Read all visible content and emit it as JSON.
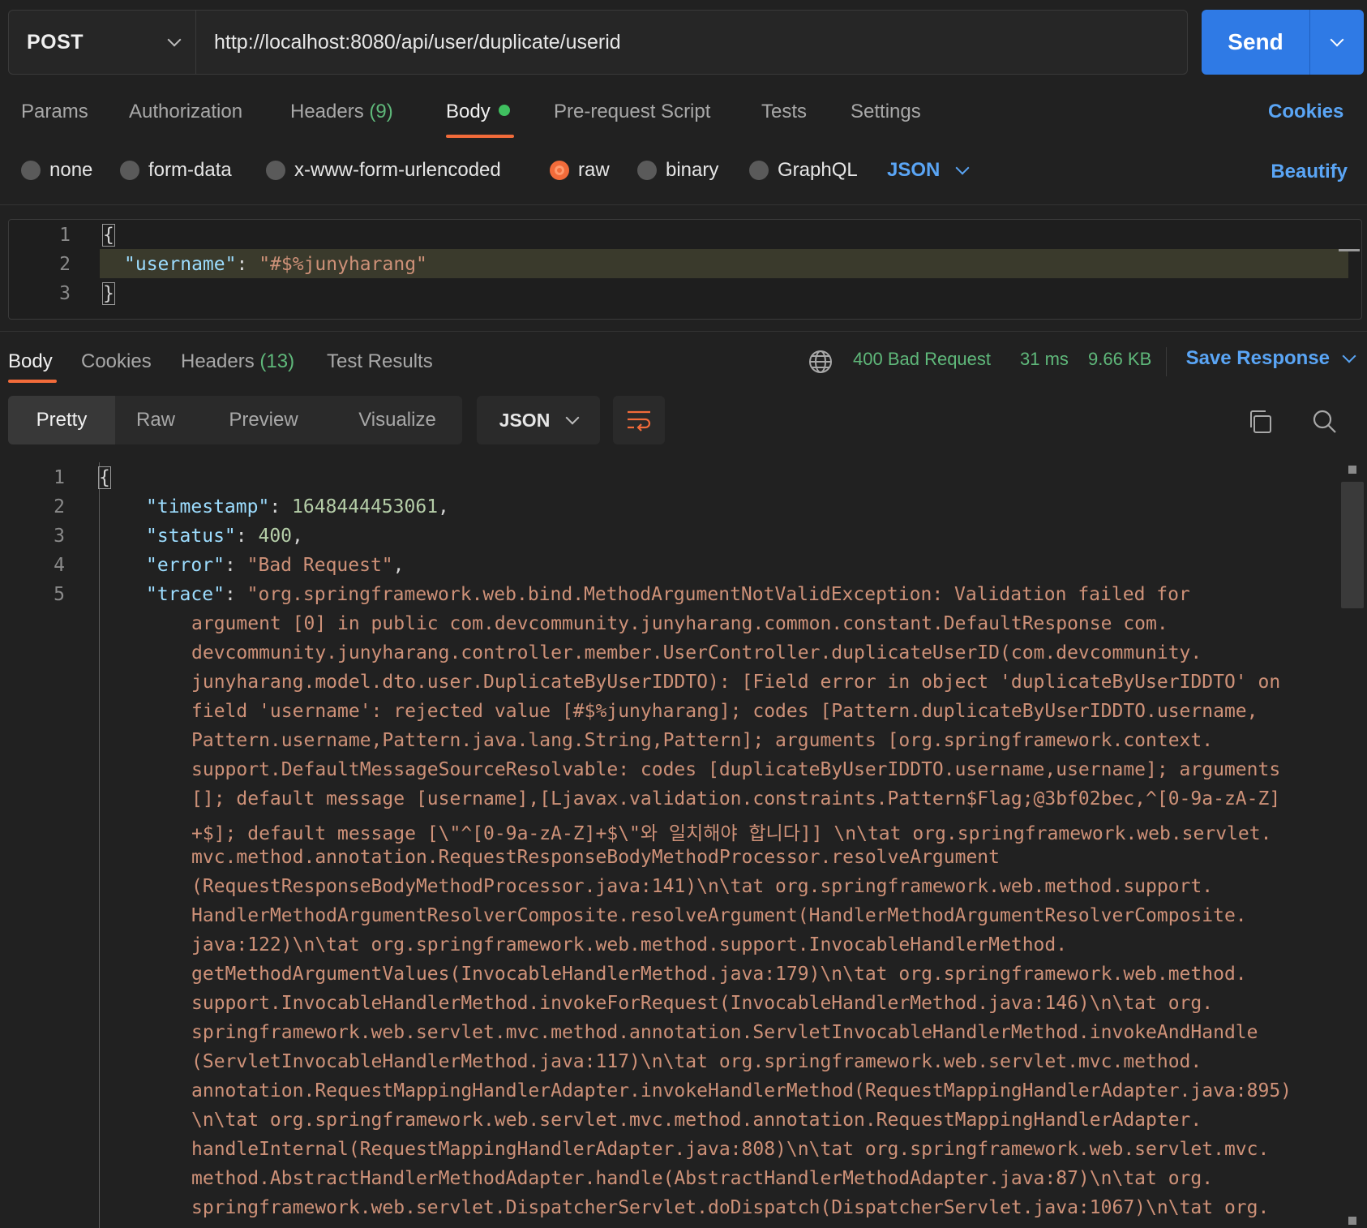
{
  "request": {
    "method": "POST",
    "url": "http://localhost:8080/api/user/duplicate/userid",
    "send_label": "Send"
  },
  "request_tabs": {
    "params": "Params",
    "authorization": "Authorization",
    "headers": "Headers",
    "headers_count": "(9)",
    "body": "Body",
    "pre_request": "Pre-request Script",
    "tests": "Tests",
    "settings": "Settings",
    "cookies": "Cookies"
  },
  "body_types": {
    "none": "none",
    "form_data": "form-data",
    "urlencoded": "x-www-form-urlencoded",
    "raw": "raw",
    "binary": "binary",
    "graphql": "GraphQL",
    "format": "JSON",
    "beautify": "Beautify"
  },
  "request_body": {
    "line_numbers": [
      "1",
      "2",
      "3"
    ],
    "open_brace": "{",
    "key": "\"username\"",
    "colon": ": ",
    "value": "\"#$%junyharang\"",
    "close_brace": "}"
  },
  "response_tabs": {
    "body": "Body",
    "cookies": "Cookies",
    "headers": "Headers",
    "headers_count": "(13)",
    "test_results": "Test Results"
  },
  "response_status": {
    "status": "400 Bad Request",
    "time": "31 ms",
    "size": "9.66 KB",
    "save_response": "Save Response"
  },
  "view_modes": {
    "pretty": "Pretty",
    "raw": "Raw",
    "preview": "Preview",
    "visualize": "Visualize",
    "language": "JSON"
  },
  "response_body": {
    "line_numbers": [
      "1",
      "2",
      "3",
      "4",
      "5"
    ],
    "open_brace": "{",
    "timestamp_key": "\"timestamp\"",
    "timestamp_value": "1648444453061",
    "status_key": "\"status\"",
    "status_value": "400",
    "error_key": "\"error\"",
    "error_value": "\"Bad Request\"",
    "trace_key": "\"trace\"",
    "trace_lines": [
      "\"org.springframework.web.bind.MethodArgumentNotValidException: Validation failed for",
      "argument [0] in public com.devcommunity.junyharang.common.constant.DefaultResponse com.",
      "devcommunity.junyharang.controller.member.UserController.duplicateUserID(com.devcommunity.",
      "junyharang.model.dto.user.DuplicateByUserIDDTO): [Field error in object 'duplicateByUserIDDTO' on",
      "field 'username': rejected value [#$%junyharang]; codes [Pattern.duplicateByUserIDDTO.username,",
      "Pattern.username,Pattern.java.lang.String,Pattern]; arguments [org.springframework.context.",
      "support.DefaultMessageSourceResolvable: codes [duplicateByUserIDDTO.username,username]; arguments",
      "[]; default message [username],[Ljavax.validation.constraints.Pattern$Flag;@3bf02bec,^[0-9a-zA-Z]",
      "+$]; default message [\\\"^[0-9a-zA-Z]+$\\\"와 일치해야 합니다]] \\n\\tat org.springframework.web.servlet.",
      "mvc.method.annotation.RequestResponseBodyMethodProcessor.resolveArgument",
      "(RequestResponseBodyMethodProcessor.java:141)\\n\\tat org.springframework.web.method.support.",
      "HandlerMethodArgumentResolverComposite.resolveArgument(HandlerMethodArgumentResolverComposite.",
      "java:122)\\n\\tat org.springframework.web.method.support.InvocableHandlerMethod.",
      "getMethodArgumentValues(InvocableHandlerMethod.java:179)\\n\\tat org.springframework.web.method.",
      "support.InvocableHandlerMethod.invokeForRequest(InvocableHandlerMethod.java:146)\\n\\tat org.",
      "springframework.web.servlet.mvc.method.annotation.ServletInvocableHandlerMethod.invokeAndHandle",
      "(ServletInvocableHandlerMethod.java:117)\\n\\tat org.springframework.web.servlet.mvc.method.",
      "annotation.RequestMappingHandlerAdapter.invokeHandlerMethod(RequestMappingHandlerAdapter.java:895)",
      "\\n\\tat org.springframework.web.servlet.mvc.method.annotation.RequestMappingHandlerAdapter.",
      "handleInternal(RequestMappingHandlerAdapter.java:808)\\n\\tat org.springframework.web.servlet.mvc.",
      "method.AbstractHandlerMethodAdapter.handle(AbstractHandlerMethodAdapter.java:87)\\n\\tat org.",
      "springframework.web.servlet.DispatcherServlet.doDispatch(DispatcherServlet.java:1067)\\n\\tat org."
    ]
  }
}
